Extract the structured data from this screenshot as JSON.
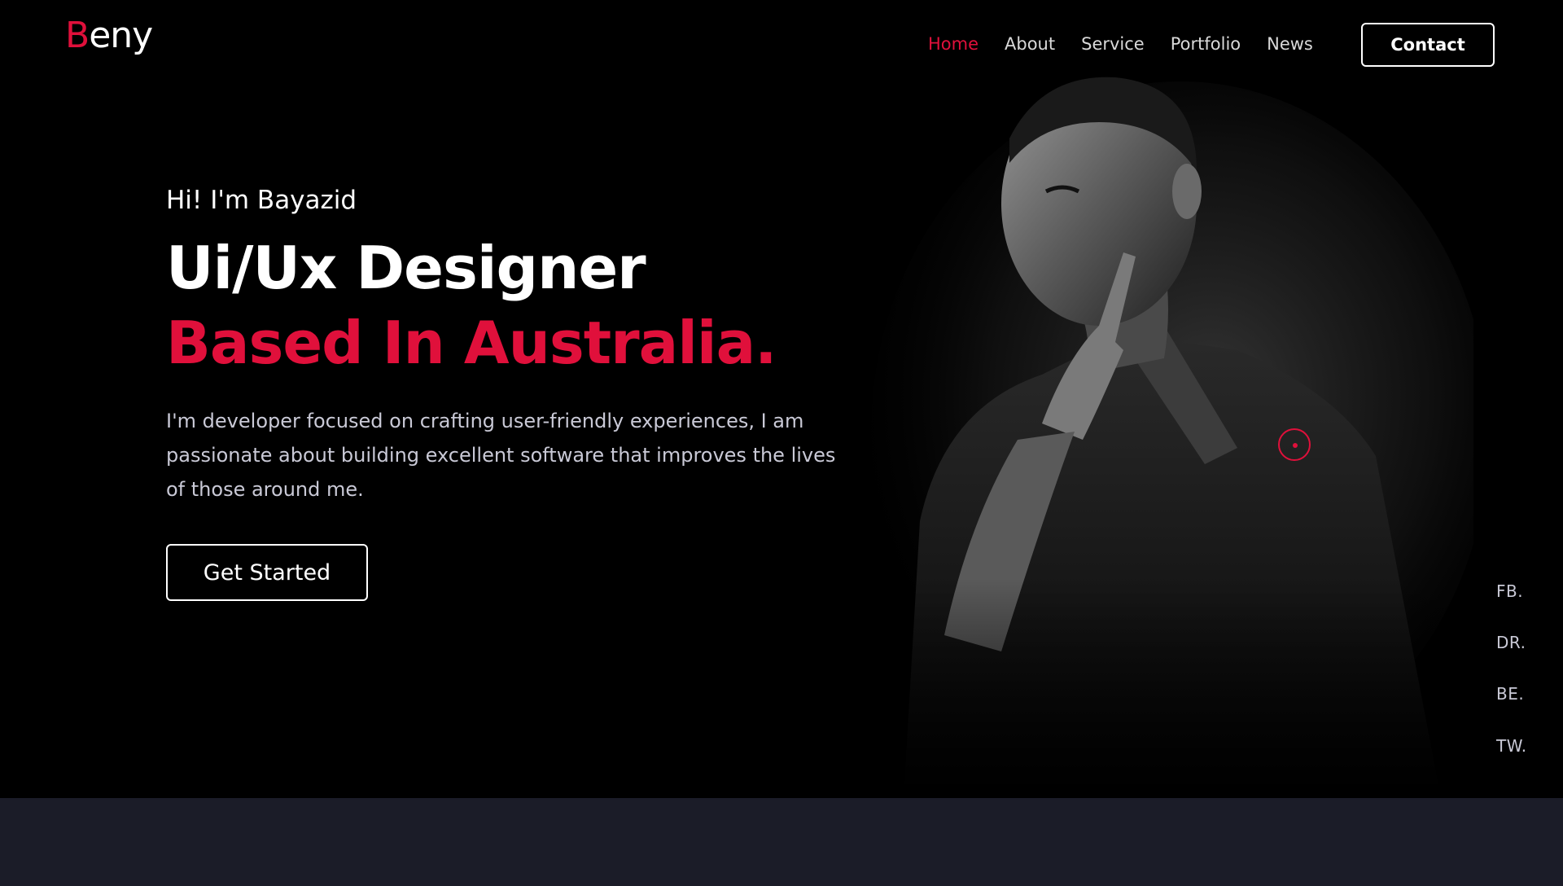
{
  "brand": {
    "first_letter": "B",
    "rest": "eny"
  },
  "nav": {
    "items": [
      {
        "label": "Home",
        "active": true
      },
      {
        "label": "About",
        "active": false
      },
      {
        "label": "Service",
        "active": false
      },
      {
        "label": "Portfolio",
        "active": false
      },
      {
        "label": "News",
        "active": false
      }
    ],
    "contact_label": "Contact"
  },
  "hero": {
    "greeting": "Hi! I'm Bayazid",
    "title_line_1": "Ui/Ux Designer",
    "title_line_2": "Based In Australia.",
    "description": "I'm developer focused on crafting user-friendly experiences, I am passionate about building excellent software that improves the lives of those around me.",
    "cta_label": "Get Started"
  },
  "social": [
    "FB.",
    "DR.",
    "BE.",
    "TW."
  ],
  "colors": {
    "accent": "#e0103b",
    "background": "#000000",
    "section_below": "#1b1c28",
    "muted_text": "#c9c9d6"
  }
}
